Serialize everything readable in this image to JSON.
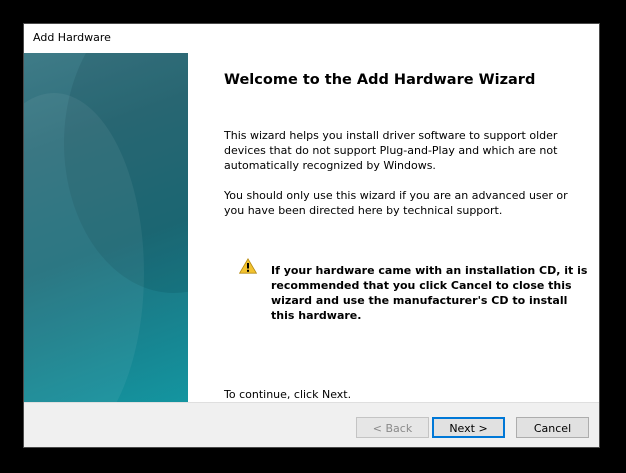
{
  "window": {
    "title": "Add Hardware"
  },
  "wizard": {
    "heading": "Welcome to the Add Hardware Wizard",
    "paragraph1": "This wizard helps you install driver software to support older devices that do not support Plug-and-Play and which are not automatically recognized by Windows.",
    "paragraph2": "You should only use this wizard if you are an advanced user or you have been directed here by technical support.",
    "warning": "If your hardware came with an installation CD, it is recommended that you click Cancel to close this wizard and use the manufacturer's CD to install this hardware.",
    "continue_text": "To continue, click Next."
  },
  "buttons": {
    "back_label": "< Back",
    "next_label": "Next >",
    "cancel_label": "Cancel"
  },
  "colors": {
    "banner_teal": "#1f6f7c",
    "warning_yellow": "#f2c230",
    "focus_blue": "#0078d7"
  },
  "icons": {
    "warning": "warning-triangle-icon"
  }
}
